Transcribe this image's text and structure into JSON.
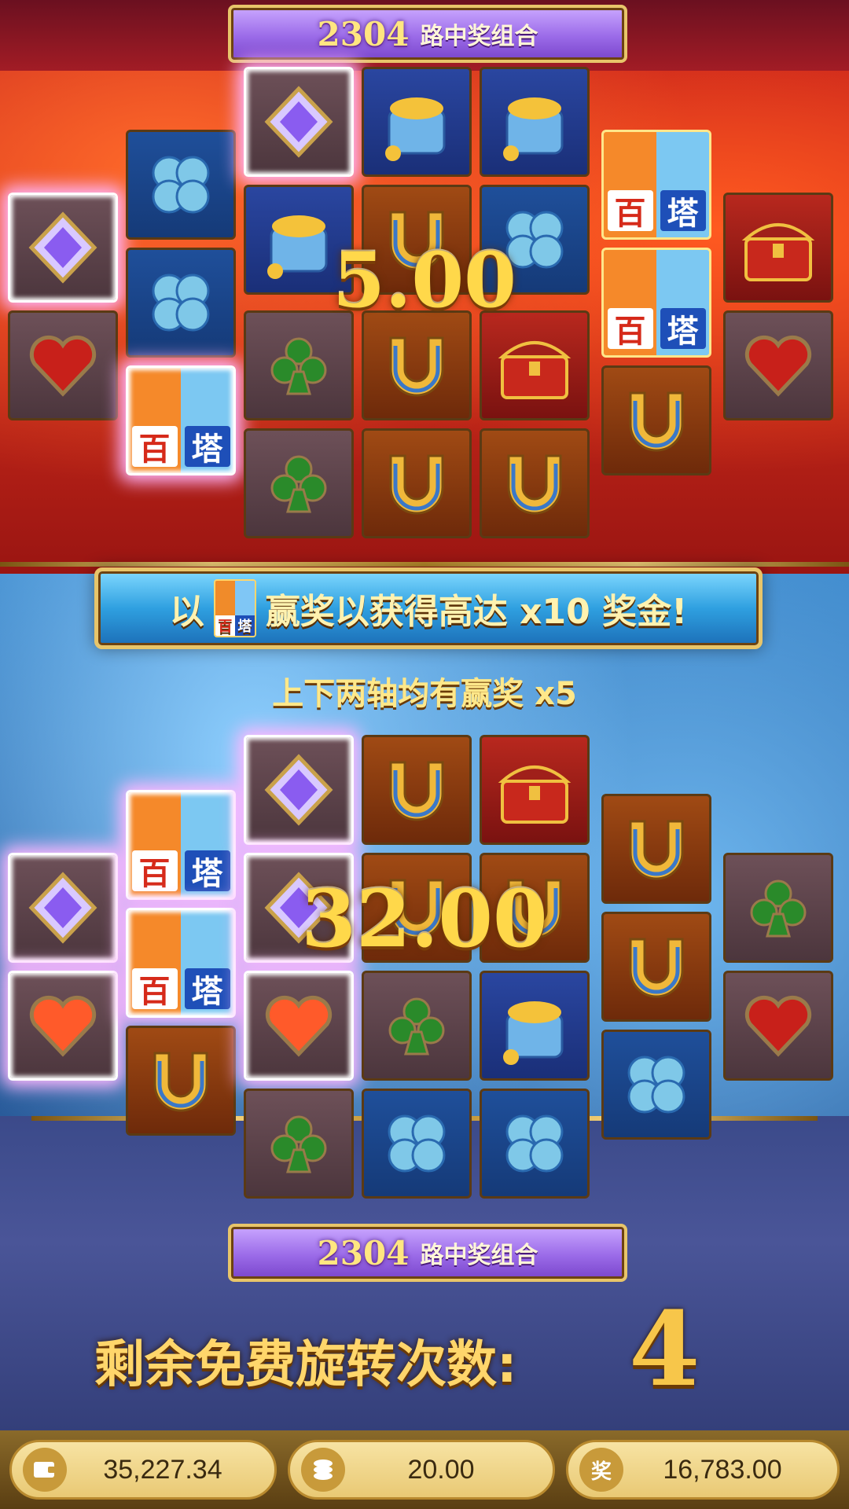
{
  "top_reels": {
    "ways_count": "2304",
    "ways_label": "路中奖组合",
    "win_amount": "5.00"
  },
  "promo_banner": {
    "prefix": "以",
    "suffix": "赢奖以获得高达 x10 奖金!",
    "wild_chars": [
      "百",
      "塔"
    ]
  },
  "multiplier_text": "上下两轴均有赢奖 x5",
  "bottom_reels": {
    "win_amount": "32.00",
    "ways_count": "2304",
    "ways_label": "路中奖组合"
  },
  "free_spins": {
    "label": "剩余免费旋转次数:",
    "count": "4"
  },
  "status_bar": {
    "balance": "35,227.34",
    "bet": "20.00",
    "win": "16,783.00",
    "win_icon_label": "奖"
  },
  "wild_symbol": {
    "char_left": "百",
    "char_right": "塔"
  },
  "icons": {
    "wallet": "wallet-icon",
    "coins": "coin-stack-icon",
    "win": "win-badge-icon"
  },
  "colors": {
    "gold": "#e8c56a",
    "top_bg": "#c8201a",
    "bottom_bg": "#2c64a6",
    "banner_purple": "#9b6be8"
  }
}
